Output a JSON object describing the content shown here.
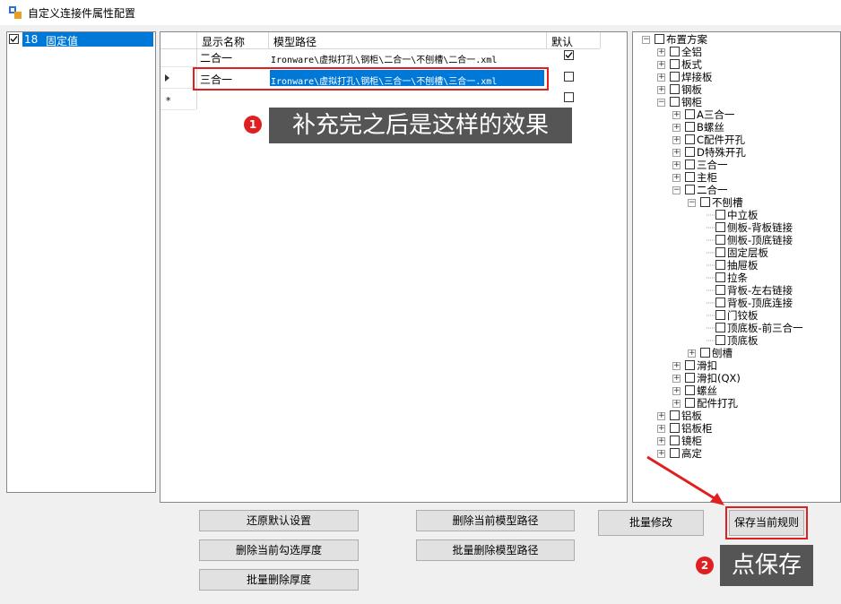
{
  "window": {
    "title": "自定义连接件属性配置"
  },
  "left_list": {
    "items": [
      {
        "id": "18",
        "label": "固定值",
        "checked": true
      }
    ]
  },
  "grid": {
    "headers": [
      "显示名称",
      "模型路径",
      "默认"
    ],
    "rows": [
      {
        "name": "二合一",
        "path": "Ironware\\虚拟打孔\\钢柜\\二合一\\不刨槽\\二合一.xml",
        "default": true
      },
      {
        "name": "三合一",
        "path": "Ironware\\虚拟打孔\\钢柜\\三合一\\不刨槽\\三合一.xml",
        "default": false
      }
    ],
    "new_row_marker": "*"
  },
  "annotations": {
    "callout1": {
      "num": "1",
      "text": "补充完之后是这样的效果"
    },
    "callout2": {
      "num": "2",
      "text": "点保存"
    }
  },
  "tree": [
    {
      "label": "布置方案",
      "level": 0,
      "exp": "−"
    },
    {
      "label": "全铝",
      "level": 1,
      "exp": "+"
    },
    {
      "label": "板式",
      "level": 1,
      "exp": "+"
    },
    {
      "label": "焊接板",
      "level": 1,
      "exp": "+"
    },
    {
      "label": "钢板",
      "level": 1,
      "exp": "+"
    },
    {
      "label": "钢柜",
      "level": 1,
      "exp": "−"
    },
    {
      "label": "A三合一",
      "level": 2,
      "exp": "+"
    },
    {
      "label": "B螺丝",
      "level": 2,
      "exp": "+"
    },
    {
      "label": "C配件开孔",
      "level": 2,
      "exp": "+"
    },
    {
      "label": "D特殊开孔",
      "level": 2,
      "exp": "+"
    },
    {
      "label": "三合一",
      "level": 2,
      "exp": "+"
    },
    {
      "label": "主柜",
      "level": 2,
      "exp": "+"
    },
    {
      "label": "二合一",
      "level": 2,
      "exp": "−"
    },
    {
      "label": "不刨槽",
      "level": 3,
      "exp": "−"
    },
    {
      "label": "中立板",
      "level": 4,
      "exp": ""
    },
    {
      "label": "侧板-背板链接",
      "level": 4,
      "exp": ""
    },
    {
      "label": "侧板-顶底链接",
      "level": 4,
      "exp": ""
    },
    {
      "label": "固定层板",
      "level": 4,
      "exp": ""
    },
    {
      "label": "抽屉板",
      "level": 4,
      "exp": ""
    },
    {
      "label": "拉条",
      "level": 4,
      "exp": ""
    },
    {
      "label": "背板-左右链接",
      "level": 4,
      "exp": ""
    },
    {
      "label": "背板-顶底连接",
      "level": 4,
      "exp": ""
    },
    {
      "label": "门铰板",
      "level": 4,
      "exp": ""
    },
    {
      "label": "顶底板-前三合一",
      "level": 4,
      "exp": ""
    },
    {
      "label": "顶底板",
      "level": 4,
      "exp": ""
    },
    {
      "label": "刨槽",
      "level": 3,
      "exp": "+"
    },
    {
      "label": "滑扣",
      "level": 2,
      "exp": "+"
    },
    {
      "label": "滑扣(QX)",
      "level": 2,
      "exp": "+"
    },
    {
      "label": "螺丝",
      "level": 2,
      "exp": "+"
    },
    {
      "label": "配件打孔",
      "level": 2,
      "exp": "+"
    },
    {
      "label": "铝板",
      "level": 1,
      "exp": "+"
    },
    {
      "label": "铝板柜",
      "level": 1,
      "exp": "+"
    },
    {
      "label": "镜柜",
      "level": 1,
      "exp": "+"
    },
    {
      "label": "高定",
      "level": 1,
      "exp": "+"
    }
  ],
  "buttons": {
    "restore_default": "还原默认设置",
    "delete_checked_thickness": "删除当前勾选厚度",
    "batch_delete_thickness": "批量删除厚度",
    "delete_current_model_path": "删除当前模型路径",
    "batch_delete_model_path": "批量删除模型路径",
    "batch_modify": "批量修改",
    "save_current_rule": "保存当前规则"
  },
  "colors": {
    "selection": "#0078d7",
    "annotation_red": "#e02020",
    "callout_bg": "#555555"
  }
}
